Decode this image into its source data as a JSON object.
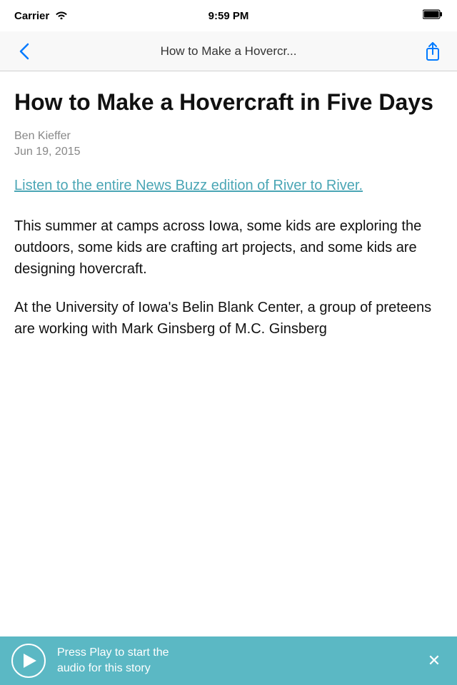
{
  "status_bar": {
    "carrier": "Carrier",
    "time": "9:59 PM"
  },
  "nav": {
    "title": "How to Make a Hovercr...",
    "back_label": "‹",
    "share_label": "Share"
  },
  "article": {
    "title": "How to Make a Hovercraft in Five Days",
    "author": "Ben Kieffer",
    "date": "Jun 19, 2015",
    "link_text": "Listen to the entire News Buzz edition of River to River.",
    "body_paragraph_1": "This summer at camps across Iowa, some kids are exploring the outdoors, some kids are crafting art projects, and some kids are designing hovercraft.",
    "body_paragraph_2": "At the University of Iowa's Belin Blank Center, a group of preteens are working with Mark Ginsberg of M.C. Ginsberg"
  },
  "audio": {
    "text_line1": "Press Play to start the",
    "text_line2": "audio for this story"
  },
  "colors": {
    "accent": "#4ba6b5",
    "audio_bar": "#5bb8c4"
  }
}
